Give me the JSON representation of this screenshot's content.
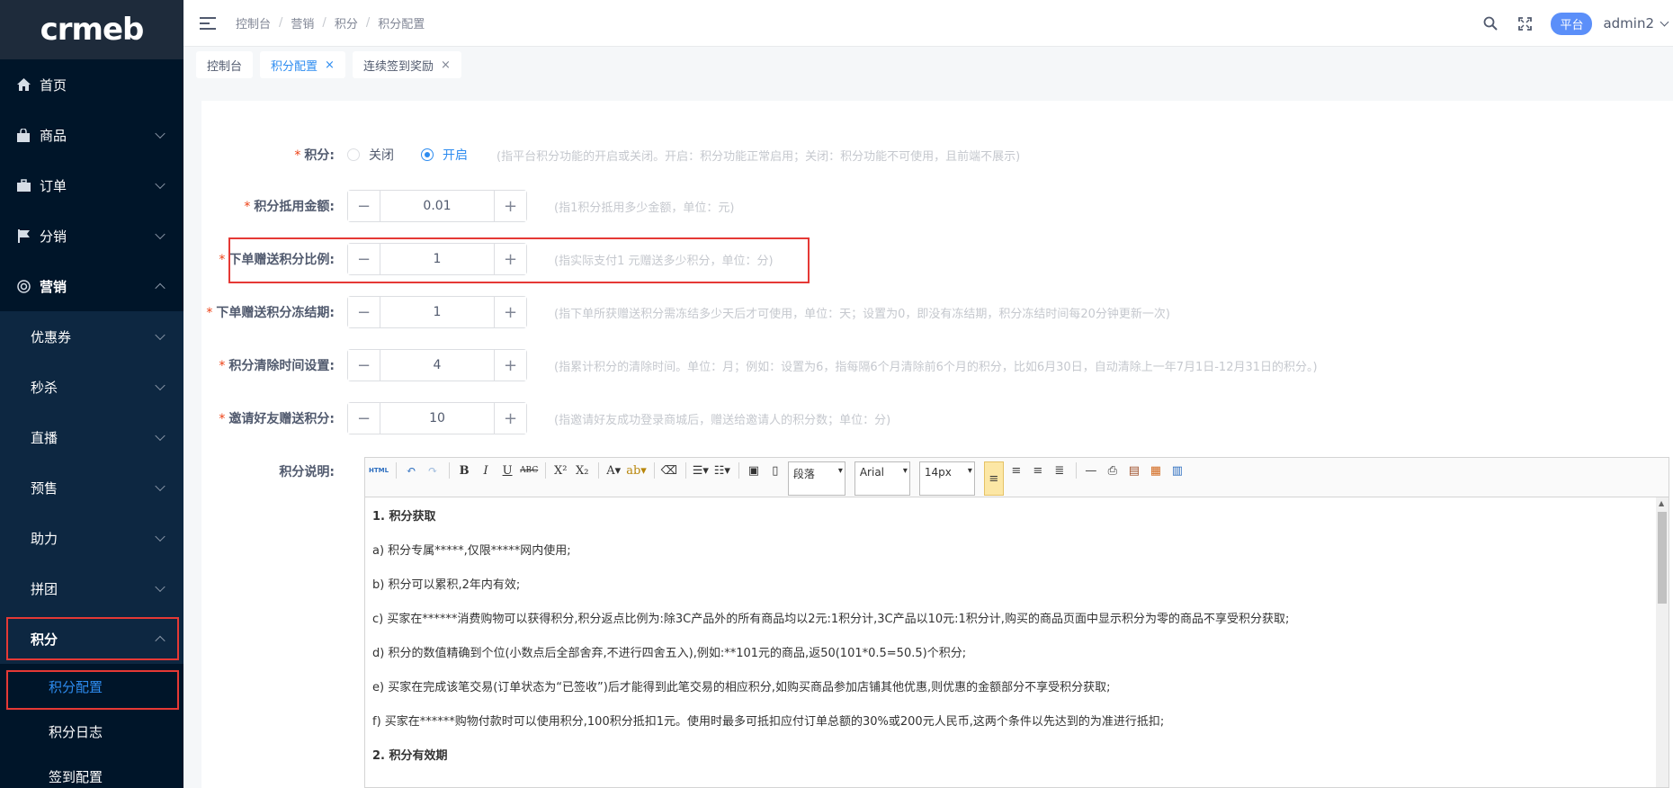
{
  "logo": "crmeb",
  "sidebar": {
    "items": [
      {
        "label": "首页",
        "icon": "home-icon"
      },
      {
        "label": "商品",
        "icon": "bag-icon"
      },
      {
        "label": "订单",
        "icon": "briefcase-icon"
      },
      {
        "label": "分销",
        "icon": "flag-icon"
      },
      {
        "label": "营销",
        "icon": "marketing-icon"
      }
    ],
    "marketing_sub": [
      {
        "label": "优惠券"
      },
      {
        "label": "秒杀"
      },
      {
        "label": "直播"
      },
      {
        "label": "预售"
      },
      {
        "label": "助力"
      },
      {
        "label": "拼团"
      },
      {
        "label": "积分"
      }
    ],
    "points_sub": [
      {
        "label": "积分配置"
      },
      {
        "label": "积分日志"
      },
      {
        "label": "签到配置"
      }
    ]
  },
  "breadcrumb": [
    "控制台",
    "营销",
    "积分",
    "积分配置"
  ],
  "header": {
    "platform": "平台",
    "user": "admin2"
  },
  "tabs": [
    {
      "label": "控制台"
    },
    {
      "label": "积分配置",
      "close": "×"
    },
    {
      "label": "连续签到奖励",
      "close": "×"
    }
  ],
  "form": {
    "points": {
      "label": "积分:",
      "off": "关闭",
      "on": "开启",
      "hint": "(指平台积分功能的开启或关闭。开启：积分功能正常启用；关闭：积分功能不可使用，且前端不展示)"
    },
    "deduct": {
      "label": "积分抵用金额:",
      "value": "0.01",
      "hint": "(指1积分抵用多少金额，单位：元)"
    },
    "ratio": {
      "label": "下单赠送积分比例:",
      "value": "1",
      "hint": "(指实际支付1 元赠送多少积分，单位：分)"
    },
    "freeze": {
      "label": "下单赠送积分冻结期:",
      "value": "1",
      "hint": "(指下单所获赠送积分需冻结多少天后才可使用，单位：天；设置为0，即没有冻结期，积分冻结时间每20分钟更新一次)"
    },
    "clear": {
      "label": "积分清除时间设置:",
      "value": "4",
      "hint": "(指累计积分的清除时间。单位：月；例如：设置为6，指每隔6个月清除前6个月的积分，比如6月30日，自动清除上一年7月1日-12月31日的积分。)"
    },
    "invite": {
      "label": "邀请好友赠送积分:",
      "value": "10",
      "hint": "(指邀请好友成功登录商城后，赠送给邀请人的积分数；单位：分)"
    },
    "desc_label": "积分说明:"
  },
  "editor": {
    "toolbar": {
      "html": "HTML",
      "paragraph": "段落",
      "font": "Arial",
      "size": "14px"
    },
    "content": [
      {
        "text": "1. 积分获取",
        "bold": true
      },
      {
        "text": "a)  积分专属*****,仅限*****网内使用;"
      },
      {
        "text": "b)  积分可以累积,2年内有效;"
      },
      {
        "text": "c)  买家在******消费购物可以获得积分,积分返点比例为:除3C产品外的所有商品均以2元:1积分计,3C产品以10元:1积分计,购买的商品页面中显示积分为零的商品不享受积分获取;"
      },
      {
        "text": "d)  积分的数值精确到个位(小数点后全部舍弃,不进行四舍五入),例如:**101元的商品,返50(101*0.5=50.5)个积分;"
      },
      {
        "text": "e)  买家在完成该笔交易(订单状态为“已签收”)后才能得到此笔交易的相应积分,如购买商品参加店铺其他优惠,则优惠的金额部分不享受积分获取;"
      },
      {
        "text": "f)  买家在******购物付款时可以使用积分,100积分抵扣1元。使用时最多可抵扣应付订单总额的30%或200元人民币,这两个条件以先达到的为准进行抵扣;"
      },
      {
        "text": "2. 积分有效期",
        "bold": true
      }
    ]
  }
}
